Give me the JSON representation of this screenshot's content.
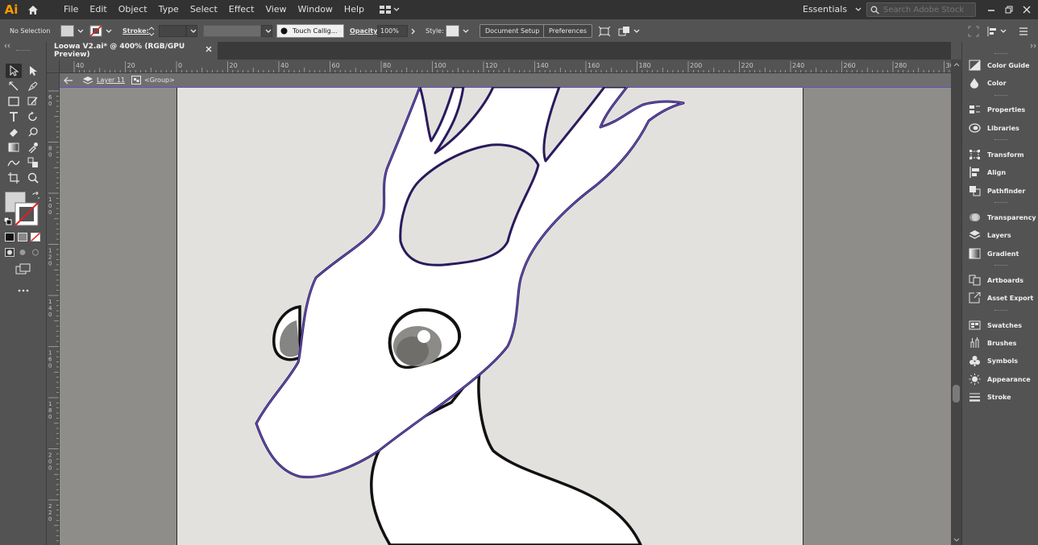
{
  "app": {
    "logo_text": "Ai",
    "menu": [
      "File",
      "Edit",
      "Object",
      "Type",
      "Select",
      "Effect",
      "View",
      "Window",
      "Help"
    ],
    "workspace": "Essentials",
    "search_placeholder": "Search Adobe Stock"
  },
  "control_bar": {
    "selection_status": "No Selection",
    "stroke_label": "Stroke:",
    "brush_name": "Touch Callig...",
    "opacity_label": "Opacity:",
    "opacity_value": "100%",
    "style_label": "Style:",
    "document_setup": "Document Setup",
    "preferences": "Preferences"
  },
  "document_tab": {
    "title": "Loowa V2.ai* @ 400% (RGB/GPU Preview)"
  },
  "isolation": {
    "layer": "Layer 11",
    "group": "<Group>"
  },
  "ruler": {
    "h_labels": [
      "40",
      "20",
      "0",
      "20",
      "40",
      "60",
      "80",
      "100",
      "120",
      "140",
      "160",
      "180",
      "200",
      "220",
      "240",
      "260",
      "280",
      "30"
    ],
    "v_labels": [
      "6\n0",
      "8\n0",
      "1\n0\n0",
      "1\n2\n0",
      "1\n4\n0",
      "1\n6\n0",
      "1\n8\n0",
      "2\n0\n0",
      "2\n2\n0"
    ]
  },
  "panels": [
    {
      "label": "Color Guide",
      "icon": "color-guide-icon"
    },
    {
      "label": "Color",
      "icon": "color-icon"
    },
    {
      "label": "Properties",
      "icon": "properties-icon"
    },
    {
      "label": "Libraries",
      "icon": "libraries-icon"
    },
    {
      "label": "Transform",
      "icon": "transform-icon"
    },
    {
      "label": "Align",
      "icon": "align-icon"
    },
    {
      "label": "Pathfinder",
      "icon": "pathfinder-icon"
    },
    {
      "label": "Transparency",
      "icon": "transparency-icon"
    },
    {
      "label": "Layers",
      "icon": "layers-icon"
    },
    {
      "label": "Gradient",
      "icon": "gradient-icon"
    },
    {
      "label": "Artboards",
      "icon": "artboards-icon"
    },
    {
      "label": "Asset Export",
      "icon": "asset-export-icon"
    },
    {
      "label": "Swatches",
      "icon": "swatches-icon"
    },
    {
      "label": "Brushes",
      "icon": "brushes-icon"
    },
    {
      "label": "Symbols",
      "icon": "symbols-icon"
    },
    {
      "label": "Appearance",
      "icon": "appearance-icon"
    },
    {
      "label": "Stroke",
      "icon": "stroke-icon"
    }
  ],
  "colors": {
    "accent_logo": "#ff9a00",
    "selection_outline": "#6a4cc4",
    "artboard": "#e3e1dd",
    "pasteboard": "#8e8d89"
  }
}
